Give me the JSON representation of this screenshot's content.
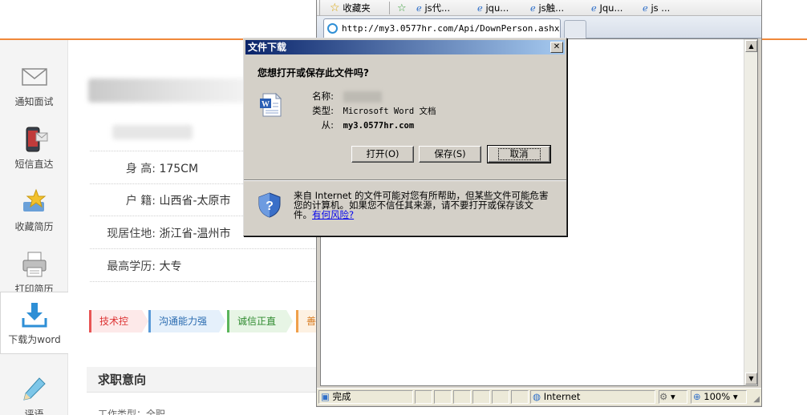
{
  "sidebar": {
    "items": [
      {
        "label": "通知面试",
        "icon": "envelope-icon"
      },
      {
        "label": "短信直达",
        "icon": "mobile-sms-icon"
      },
      {
        "label": "收藏简历",
        "icon": "favorite-star-icon"
      },
      {
        "label": "打印简历",
        "icon": "printer-icon"
      },
      {
        "label": "下载为word",
        "icon": "download-icon"
      },
      {
        "label": "评语",
        "icon": "pencil-icon"
      }
    ]
  },
  "resume": {
    "info": [
      {
        "key": "身 高:",
        "value": "175CM"
      },
      {
        "key": "户 籍:",
        "value": "山西省-太原市"
      },
      {
        "key": "现居住地:",
        "value": "浙江省-温州市"
      },
      {
        "key": "最高学历:",
        "value": "大专"
      }
    ],
    "tags": [
      "技术控",
      "沟通能力强",
      "诚信正直",
      "善于"
    ],
    "section_title": "求职意向",
    "partial_text": "工作类型：全职"
  },
  "browser": {
    "favorites_label": "收藏夹",
    "fav_links": [
      "js代...",
      "jqu...",
      "js触...",
      "Jqu...",
      "js ..."
    ],
    "tab_url": "http://my3.0577hr.com/Api/DownPerson.ashx...",
    "status": {
      "text": "完成",
      "zone": "Internet",
      "zoom": "100%"
    }
  },
  "dialog": {
    "title": "文件下载",
    "question": "您想打开或保存此文件吗?",
    "name_key": "名称:",
    "type_key": "类型:",
    "type_value": "Microsoft Word 文档",
    "from_key": "从:",
    "from_value": "my3.0577hr.com",
    "buttons": {
      "open": "打开(O)",
      "save": "保存(S)",
      "cancel": "取消"
    },
    "warning_text": "来自 Internet 的文件可能对您有所帮助，但某些文件可能危害您的计算机。如果您不信任其来源，请不要打开或保存该文件。",
    "risk_link": "有何风险?"
  },
  "colors": {
    "accent_orange": "#f0883a",
    "dialog_title_start": "#0a246a",
    "dialog_title_end": "#a6caf0",
    "window_face": "#d4d0c8"
  }
}
